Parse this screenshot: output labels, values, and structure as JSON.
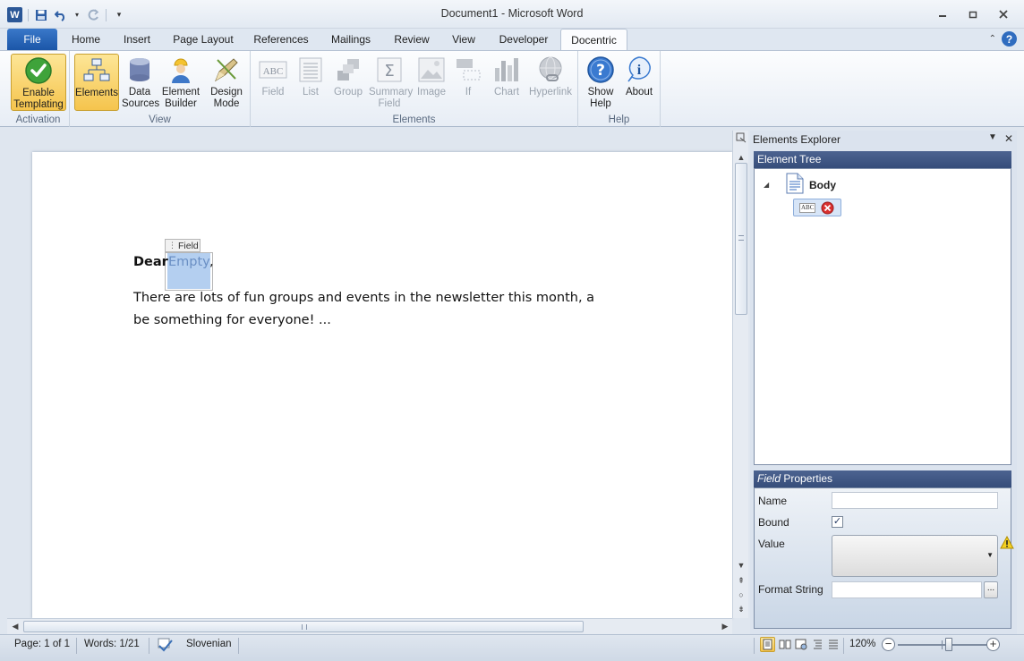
{
  "window": {
    "title": "Document1  -  Microsoft Word"
  },
  "tabs": [
    {
      "label": "File"
    },
    {
      "label": "Home"
    },
    {
      "label": "Insert"
    },
    {
      "label": "Page Layout"
    },
    {
      "label": "References"
    },
    {
      "label": "Mailings"
    },
    {
      "label": "Review"
    },
    {
      "label": "View"
    },
    {
      "label": "Developer"
    },
    {
      "label": "Docentric"
    }
  ],
  "ribbon": {
    "groups": {
      "activation": "Activation",
      "view": "View",
      "elements": "Elements",
      "help": "Help"
    },
    "buttons": {
      "enable_templating": "Enable Templating",
      "elements": "Elements",
      "data_sources": "Data Sources",
      "element_builder": "Element Builder",
      "design_mode": "Design Mode",
      "field": "Field",
      "list": "List",
      "group": "Group",
      "summary_field": "Summary Field",
      "image": "Image",
      "if": "If",
      "chart": "Chart",
      "hyperlink": "Hyperlink",
      "show_help": "Show Help",
      "about": "About"
    }
  },
  "document": {
    "field_tag": "Field",
    "dear": "Dear",
    "field_value": "Empty",
    "comma": ",",
    "line1": "There are lots of fun groups and events in the newsletter this month, a",
    "line2": "be something for everyone! ..."
  },
  "explorer": {
    "title": "Elements Explorer",
    "tree_header": "Element Tree",
    "root_node": "Body",
    "child_node_badge": "ABC",
    "props_header_italic": "Field",
    "props_header_rest": " Properties",
    "name_label": "Name",
    "name_value": "",
    "bound_label": "Bound",
    "bound_checked": true,
    "value_label": "Value",
    "format_label": "Format String",
    "format_value": "",
    "browse_button": "..."
  },
  "status": {
    "page": "Page: 1 of 1",
    "words": "Words: 1/21",
    "language": "Slovenian",
    "zoom": "120%",
    "zoom_level_percent": 120
  },
  "colors": {
    "accent": "#2b5797",
    "selection": "#b4cff0",
    "pane_header": "#3e5584",
    "pressed": "#f5c44d"
  }
}
